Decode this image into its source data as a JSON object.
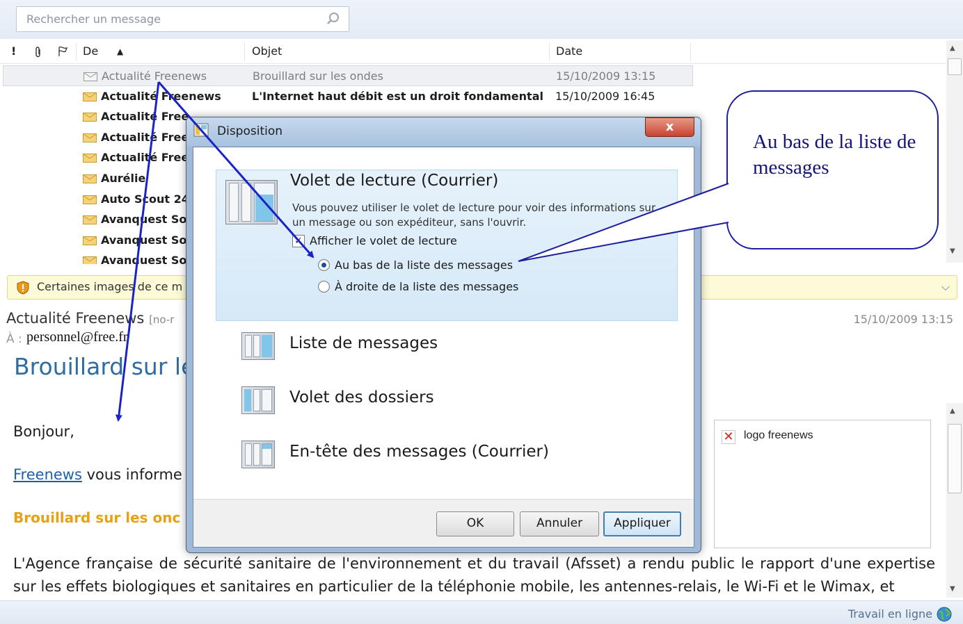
{
  "search": {
    "placeholder": "Rechercher un message"
  },
  "list": {
    "columns": {
      "importance": "!",
      "attachment": "paperclip",
      "flag": "flag",
      "from": "De",
      "sort_indicator": "▲",
      "subject": "Objet",
      "date": "Date"
    },
    "rows": [
      {
        "from": "Actualité Freenews",
        "subject": "Brouillard sur les ondes",
        "date": "15/10/2009 13:15",
        "read": true
      },
      {
        "from": "Actualité Freenews",
        "subject": "L'Internet haut débit est un droit fondamental",
        "date": "15/10/2009 16:45",
        "read": false
      },
      {
        "from": "Actualité Free",
        "subject": "",
        "date": "",
        "read": false
      },
      {
        "from": "Actualité Free",
        "subject": "",
        "date": "",
        "read": false
      },
      {
        "from": "Actualité Free",
        "subject": "",
        "date": "",
        "read": false
      },
      {
        "from": "Aurélie",
        "subject": "",
        "date": "",
        "read": false
      },
      {
        "from": "Auto Scout 24",
        "subject": "",
        "date": "",
        "read": false
      },
      {
        "from": "Avanquest So",
        "subject": "",
        "date": "",
        "read": false
      },
      {
        "from": "Avanquest So",
        "subject": "",
        "date": "",
        "read": false
      },
      {
        "from": "Avanquest So",
        "subject": "",
        "date": "",
        "read": false
      }
    ]
  },
  "infobar": {
    "text": "Certaines images de ce m"
  },
  "preview": {
    "from": "Actualité Freenews",
    "from_extra": "[no-r",
    "date": "15/10/2009 13:15",
    "to_label": "À :",
    "to": "personnel@free.fr",
    "subject": "Brouillard sur le",
    "greeting": "Bonjour,",
    "link_text": "Freenews",
    "link_rest": " vous informe",
    "heading": "Brouillard sur les onc",
    "paragraph": "L'Agence française de sécurité sanitaire de l'environnement et du travail (Afsset) a rendu public le rapport d'une expertise sur les effets biologiques et sanitaires en particulier de la téléphonie mobile, les antennes-relais, le Wi-Fi et le Wimax, et",
    "image_alt": "logo freenews"
  },
  "status": {
    "text": "Travail en ligne"
  },
  "dialog": {
    "title": "Disposition",
    "close": "x",
    "reading_pane": {
      "title": "Volet de lecture (Courrier)",
      "description": "Vous pouvez utiliser le volet de lecture pour voir des informations sur un message ou son expéditeur, sans l'ouvrir.",
      "checkbox_label": "Afficher le volet de lecture",
      "checkbox_checked": true,
      "radio_bottom": "Au bas de la liste des messages",
      "radio_right": "À droite de la liste des messages",
      "selected": "bottom"
    },
    "options": [
      {
        "label": "Liste de messages"
      },
      {
        "label": "Volet des dossiers"
      },
      {
        "label": "En-tête des messages (Courrier)"
      }
    ],
    "buttons": {
      "ok": "OK",
      "cancel": "Annuler",
      "apply": "Appliquer"
    }
  },
  "callout": {
    "text": "Au bas de la liste de messages"
  },
  "colors": {
    "annotation_blue": "#1c1ca0",
    "arrow_blue": "#1a23c9",
    "link": "#1f5ea8",
    "heading_orange": "#e8a115"
  }
}
